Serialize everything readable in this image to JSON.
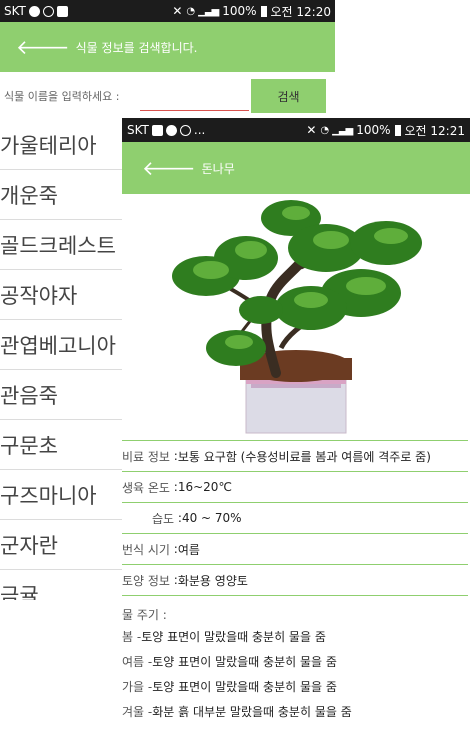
{
  "screen1": {
    "status": {
      "carrier": "SKT",
      "battery": "100%",
      "time": "오전 12:20"
    },
    "header": {
      "title": "식물 정보를 검색합니다."
    },
    "search": {
      "label": "식물 이름을 입력하세요 :",
      "button_label": "검색"
    },
    "plants": [
      "가울테리아",
      "개운죽",
      "골드크레스트",
      "공작야자",
      "관엽베고니아",
      "관음죽",
      "구문초",
      "구즈마니아",
      "군자란",
      "금귤"
    ]
  },
  "screen2": {
    "status": {
      "carrier": "SKT",
      "more": "...",
      "battery": "100%",
      "time": "오전 12:21"
    },
    "header": {
      "title": "돈나무"
    },
    "info": {
      "fertilizer": {
        "label": "비료 정보",
        "value": "보통 요구함 (수용성비료를 봄과 여름에 격주로 줌)"
      },
      "temperature": {
        "label": "생육 온도",
        "value": "16~20℃"
      },
      "humidity": {
        "label": "습도",
        "value": "40 ~ 70%"
      },
      "propagation": {
        "label": "번식 시기",
        "value": "여름"
      },
      "soil": {
        "label": "토양 정보",
        "value": "화분용 영양토"
      }
    },
    "water": {
      "label": "물 주기 :",
      "items": [
        {
          "season": "봄 -",
          "text": "토양 표면이 말랐을때 충분히 물을 줌"
        },
        {
          "season": "여름 -",
          "text": "토양 표면이 말랐을때 충분히 물을 줌"
        },
        {
          "season": "가을 -",
          "text": "토양 표면이 말랐을때 충분히 물을 줌"
        },
        {
          "season": "겨울 -",
          "text": "화분 흙 대부분 말랐을때 충분히 물을 줌"
        }
      ]
    }
  }
}
